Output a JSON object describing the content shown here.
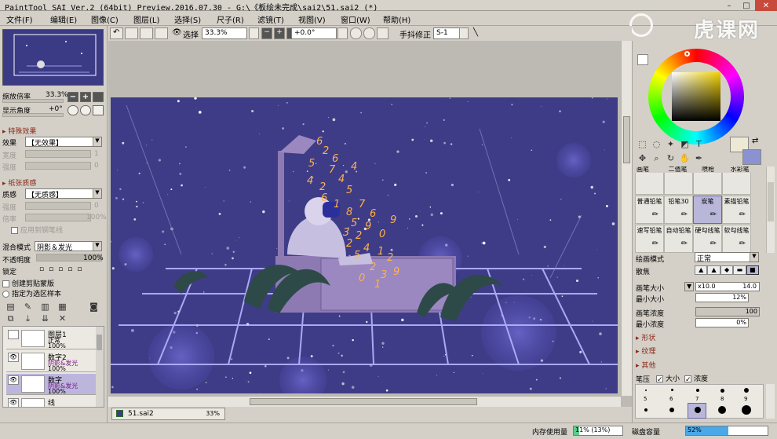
{
  "window": {
    "title": "PaintTool SAI Ver.2 (64bit) Preview.2016.07.30 - G:\\《板绘未完成\\sai2\\51.sai2 (*)"
  },
  "watermark": "虎课网",
  "menu": [
    "文件(F)",
    "编辑(E)",
    "图像(C)",
    "图层(L)",
    "选择(S)",
    "尺子(R)",
    "滤镜(T)",
    "视图(V)",
    "窗口(W)",
    "帮助(H)"
  ],
  "toolbar": {
    "select_label": "选择",
    "zoom": "33.3%",
    "rotation": "+0.0°",
    "stabilizer_label": "手抖修正",
    "stabilizer": "S-1"
  },
  "navigator": {
    "zoom_label": "缩放倍率",
    "zoom": "33.3%",
    "angle_label": "显示角度",
    "angle": "+0°"
  },
  "effects": {
    "section": "特殊效果",
    "effect_label": "效果",
    "effect": "【无效果】",
    "width_label": "宽度",
    "width": "1",
    "strength_label": "强度",
    "strength": "0"
  },
  "texture": {
    "section": "纸张质感",
    "texture_label": "质感",
    "texture": "【无质感】",
    "strength_label": "强度",
    "strength": "0",
    "scale_label": "倍率",
    "scale": "100%",
    "apply_label": "应用到钢笔线"
  },
  "layer_props": {
    "blend_label": "混合模式",
    "blend": "阴影＆发光",
    "opacity_label": "不透明度",
    "opacity": "100%",
    "lock_label": "锁定",
    "clip_label": "创建剪贴蒙版",
    "ref_label": "指定为选区样本"
  },
  "layers": [
    {
      "name": "图层1",
      "mode": "正常",
      "opacity": "100%"
    },
    {
      "name": "数字2",
      "mode": "阴影&发光",
      "opacity": "100%"
    },
    {
      "name": "数字",
      "mode": "阴影&发光",
      "opacity": "100%"
    },
    {
      "name": "线",
      "mode": "正常",
      "opacity": ""
    }
  ],
  "document": {
    "tab": "51.sai2",
    "tab_zoom": "33%",
    "art_digits": [
      "6",
      "2",
      "5",
      "6",
      "4",
      "2",
      "4",
      "5",
      "6",
      "1",
      "8",
      "7",
      "6",
      "5",
      "9",
      "2",
      "3",
      "0",
      "4",
      "1",
      "5",
      "2",
      "2",
      "3",
      "9",
      "0",
      "1",
      "2",
      "9",
      "7",
      "4"
    ]
  },
  "status": {
    "mem_label": "内存使用量",
    "mem": "11% (13%)",
    "mem_fill": 0.11,
    "disk_label": "磁盘容量",
    "disk": "52%",
    "disk_fill": 0.52
  },
  "colors": {
    "primary": "#eee9d5",
    "secondary": "#8a92d0",
    "wheel_bg": "#d4d0c8"
  },
  "brushes": {
    "row0": [
      "画笔",
      "二值笔",
      "喷枪",
      "水彩笔"
    ],
    "grid": [
      [
        "普通铅笔",
        "铅笔30",
        "炭笔",
        "素描铅笔"
      ],
      [
        "速写铅笔",
        "自动铅笔",
        "硬勾线笔",
        "软勾线笔"
      ]
    ],
    "selected": "炭笔"
  },
  "brush_settings": {
    "mode_label": "绘画模式",
    "mode": "正常",
    "edge_label": "散焦",
    "size_label": "画笔大小",
    "size_mult": "x10.0",
    "size": "14.0",
    "minsize_label": "最小大小",
    "minsize": "12%",
    "density_label": "画笔浓度",
    "density": "100",
    "mindensity_label": "最小浓度",
    "mindensity": "0%",
    "shape": "形状",
    "texture": "纹理",
    "other": "其他",
    "pressure_label": "笔压",
    "pressure_size": "大小",
    "pressure_density": "浓度",
    "dot_sizes": [
      "5",
      "6",
      "7",
      "8",
      "9"
    ]
  }
}
